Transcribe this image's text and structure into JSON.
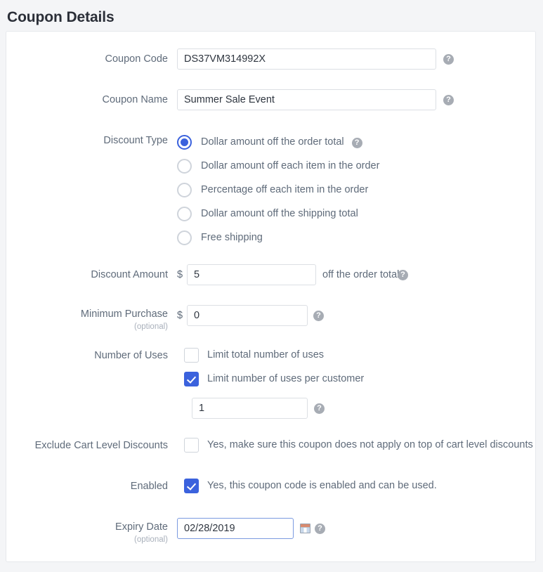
{
  "page": {
    "title": "Coupon Details"
  },
  "fields": {
    "coupon_code": {
      "label": "Coupon Code",
      "value": "DS37VM314992X",
      "placeholder": ""
    },
    "coupon_name": {
      "label": "Coupon Name",
      "value": "Summer Sale Event",
      "placeholder": ""
    },
    "discount_type": {
      "label": "Discount Type",
      "options": [
        {
          "label": "Dollar amount off the order total",
          "checked": true,
          "has_help": true
        },
        {
          "label": "Dollar amount off each item in the order",
          "checked": false,
          "has_help": false
        },
        {
          "label": "Percentage off each item in the order",
          "checked": false,
          "has_help": false
        },
        {
          "label": "Dollar amount off the shipping total",
          "checked": false,
          "has_help": false
        },
        {
          "label": "Free shipping",
          "checked": false,
          "has_help": false
        }
      ]
    },
    "discount_amount": {
      "label": "Discount Amount",
      "currency": "$",
      "value": "5",
      "suffix": "off the order total"
    },
    "minimum_purchase": {
      "label": "Minimum Purchase",
      "optional": "(optional)",
      "currency": "$",
      "value": "0"
    },
    "number_of_uses": {
      "label": "Number of Uses",
      "limit_total": {
        "label": "Limit total number of uses",
        "checked": false
      },
      "limit_per_customer": {
        "label": "Limit number of uses per customer",
        "checked": true
      },
      "uses_value": "1"
    },
    "exclude_cart_level_discounts": {
      "label": "Exclude Cart Level Discounts",
      "checkbox_label": "Yes, make sure this coupon does not apply on top of cart level discounts",
      "checked": false
    },
    "enabled": {
      "label": "Enabled",
      "checkbox_label": "Yes, this coupon code is enabled and can be used.",
      "checked": true
    },
    "expiry_date": {
      "label": "Expiry Date",
      "optional": "(optional)",
      "value": "02/28/2019",
      "focused": true
    }
  },
  "icons": {
    "help": "?",
    "help_icon_name": "help-icon",
    "calendar_icon_name": "calendar-icon"
  },
  "colors": {
    "accent": "#3b62dd",
    "label": "#5f6b7a",
    "page_bg": "#f4f5f7",
    "card_bg": "#ffffff",
    "border": "#dcdfe4"
  }
}
